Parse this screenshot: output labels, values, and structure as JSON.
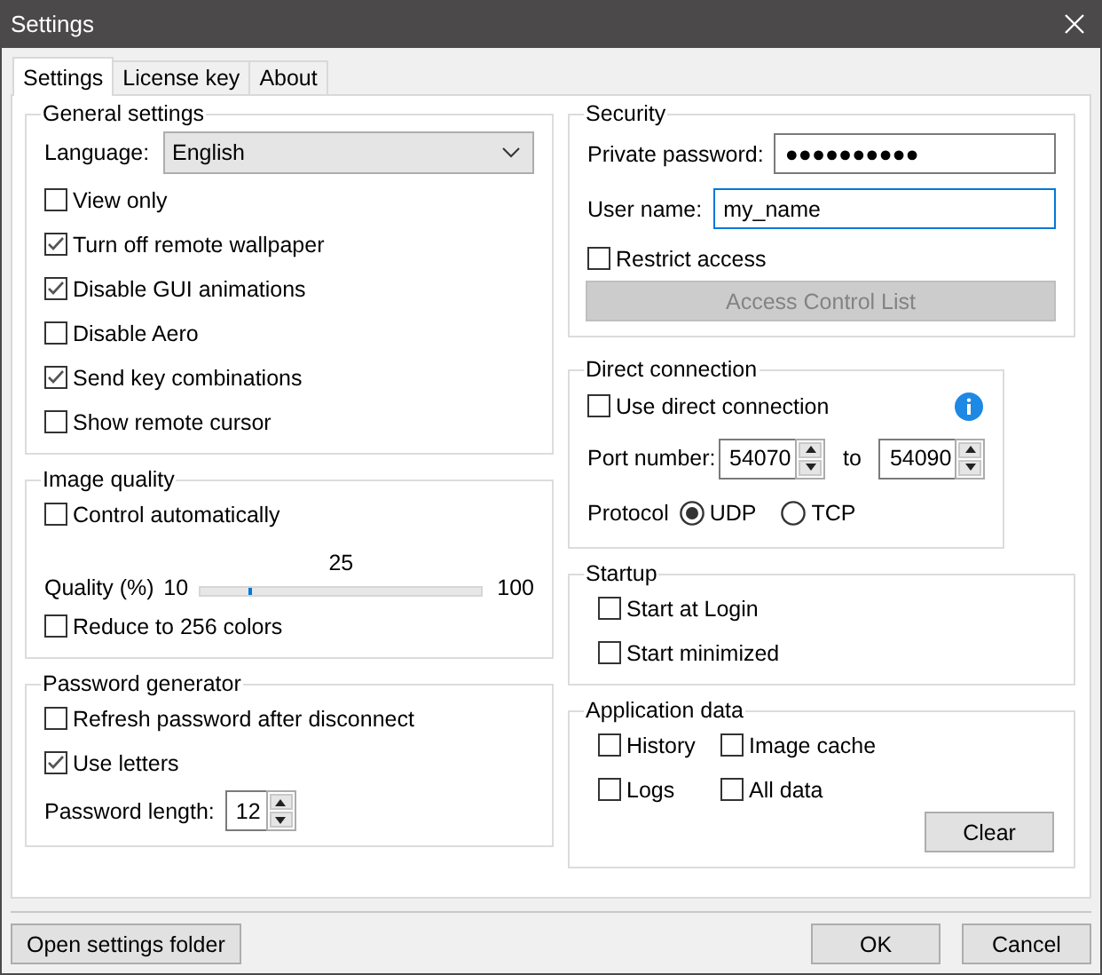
{
  "window": {
    "title": "Settings"
  },
  "tabs": [
    {
      "label": "Settings",
      "selected": true
    },
    {
      "label": "License key",
      "selected": false
    },
    {
      "label": "About",
      "selected": false
    }
  ],
  "general": {
    "title": "General settings",
    "language_label": "Language:",
    "language": "English",
    "options": [
      {
        "label": "View only",
        "checked": false
      },
      {
        "label": "Turn off remote wallpaper",
        "checked": true
      },
      {
        "label": "Disable GUI animations",
        "checked": true
      },
      {
        "label": "Disable Aero",
        "checked": false
      },
      {
        "label": "Send key combinations",
        "checked": true
      },
      {
        "label": "Show remote cursor",
        "checked": false
      }
    ]
  },
  "image_quality": {
    "title": "Image quality",
    "auto": {
      "label": "Control automatically",
      "checked": false
    },
    "quality_label": "Quality (%)",
    "min": "10",
    "max": "100",
    "reading": "25",
    "level": 0.167,
    "reduce": {
      "label": "Reduce to 256 colors",
      "checked": false
    }
  },
  "password_generator": {
    "title": "Password generator",
    "options": [
      {
        "label": "Refresh password after disconnect",
        "checked": false
      },
      {
        "label": "Use letters",
        "checked": true
      }
    ],
    "length_label": "Password length:",
    "length": "12"
  },
  "security": {
    "title": "Security",
    "password_label": "Private password:",
    "password": "●●●●●●●●●●",
    "user_label": "User name:",
    "user": "my_name",
    "restrict": {
      "label": "Restrict access",
      "checked": false
    },
    "acl_button": {
      "label": "Access Control List",
      "disabled": true
    }
  },
  "direct_connection": {
    "title": "Direct connection",
    "use": {
      "label": "Use direct connection",
      "checked": false
    },
    "port_label": "Port number:",
    "port_from": "54070",
    "to_label": "to",
    "port_to": "54090",
    "protocol_label": "Protocol",
    "protocols": [
      {
        "label": "UDP",
        "selected": true
      },
      {
        "label": "TCP",
        "selected": false
      }
    ]
  },
  "startup": {
    "title": "Startup",
    "options": [
      {
        "label": "Start at Login",
        "checked": false
      },
      {
        "label": "Start minimized",
        "checked": false
      }
    ]
  },
  "application_data": {
    "title": "Application data",
    "options": [
      {
        "label": "History",
        "checked": false
      },
      {
        "label": "Image cache",
        "checked": false
      },
      {
        "label": "Logs",
        "checked": false
      },
      {
        "label": "All data",
        "checked": false
      }
    ],
    "clear_button": "Clear"
  },
  "footer": {
    "open_folder_button": "Open settings folder",
    "ok_button": "OK",
    "cancel_button": "Cancel"
  }
}
